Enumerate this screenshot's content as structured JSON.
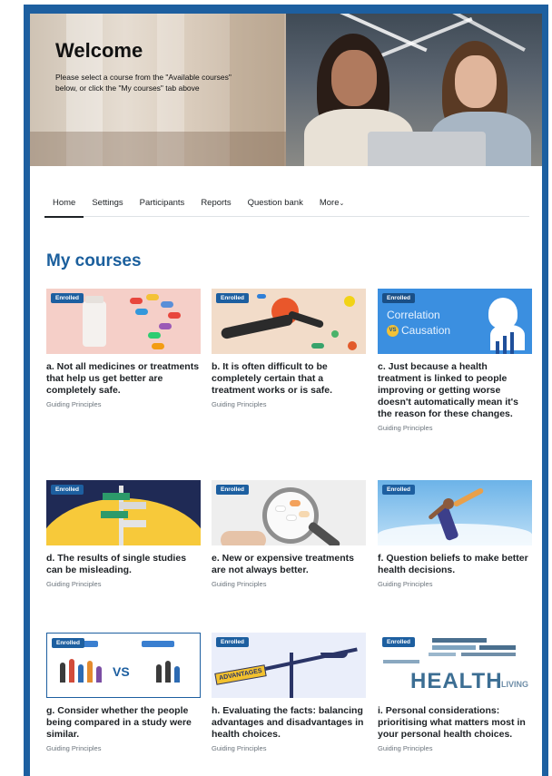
{
  "hero": {
    "title": "Welcome",
    "subtitle_line1": "Please select a course from the \"Available courses\"",
    "subtitle_line2": "below, or click the \"My courses\" tab above"
  },
  "nav": {
    "tabs": [
      {
        "label": "Home",
        "active": true
      },
      {
        "label": "Settings"
      },
      {
        "label": "Participants"
      },
      {
        "label": "Reports"
      },
      {
        "label": "Question bank"
      },
      {
        "label": "More"
      }
    ]
  },
  "section": {
    "title": "My courses"
  },
  "badge_label": "Enrolled",
  "courses": [
    {
      "title": "a. Not all medicines or treatments that help us get better are completely safe.",
      "category": "Guiding Principles"
    },
    {
      "title": "b. It is often difficult to be completely certain that a treatment works or is safe.",
      "category": "Guiding Principles"
    },
    {
      "title": "c. Just because a health treatment is linked to people improving or getting worse doesn't automatically mean it's the reason for these changes.",
      "category": "Guiding Principles",
      "thumb_text": [
        "Correlation",
        "VS",
        "Causation"
      ]
    },
    {
      "title": "d. The results of single studies can be misleading.",
      "category": "Guiding Principles"
    },
    {
      "title": "e. New or expensive treatments are not always better.",
      "category": "Guiding Principles"
    },
    {
      "title": "f. Question beliefs to make better health decisions.",
      "category": "Guiding Principles"
    },
    {
      "title": "g. Consider whether the people being compared in a study were similar.",
      "category": "Guiding Principles",
      "thumb_text": [
        "VS"
      ]
    },
    {
      "title": "h. Evaluating the facts: balancing advantages and disadvantages in health choices.",
      "category": "Guiding Principles",
      "thumb_text": [
        "ADVANTAGES"
      ]
    },
    {
      "title": "i. Personal considerations: prioritising what matters most in your personal health choices.",
      "category": "Guiding Principles",
      "thumb_text": [
        "HEALTH",
        "LIVING"
      ]
    }
  ],
  "colors": {
    "brand": "#1d5fa0",
    "title_blue": "#1b5f9d"
  }
}
